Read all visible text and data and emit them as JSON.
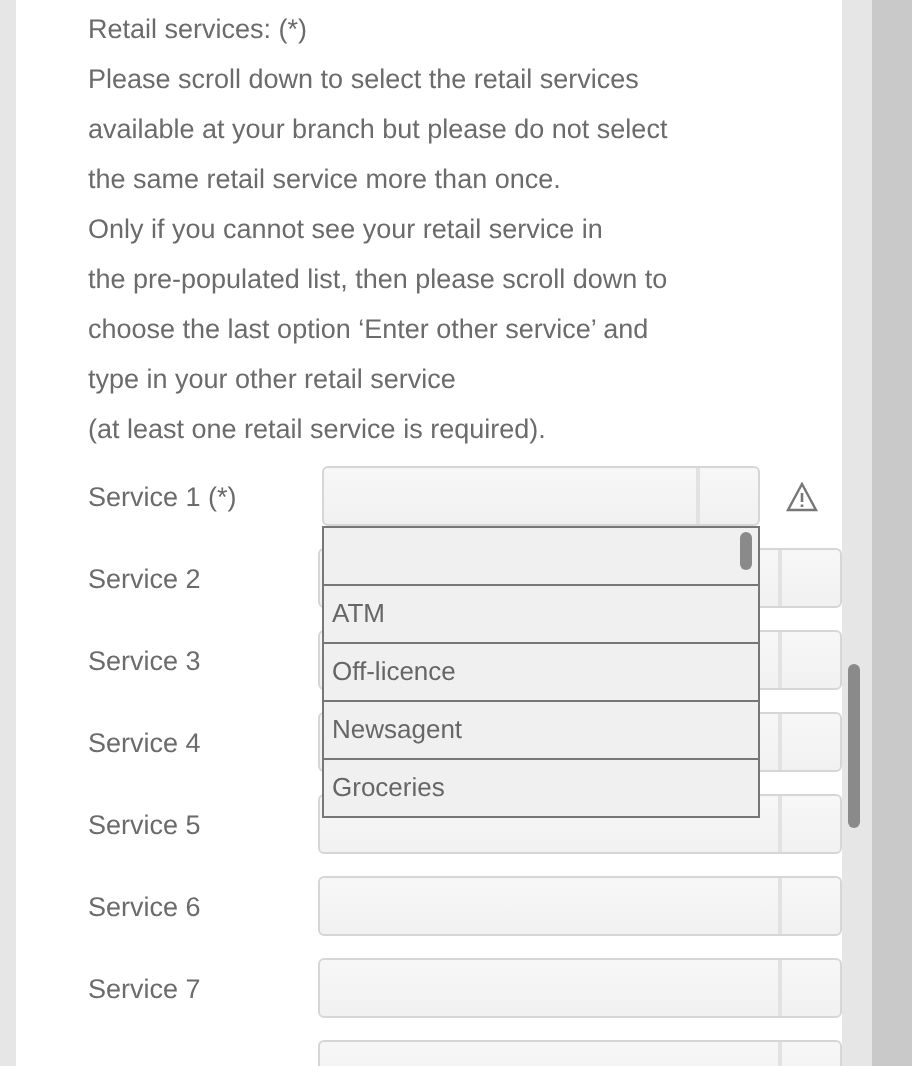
{
  "section": {
    "title": "Retail services: (*)",
    "instructions": [
      "Please scroll down to select the retail services",
      "available at your branch but please do not select",
      "the same retail service more than once.",
      "Only if you cannot see your retail service in",
      "the pre-populated list, then please scroll down to",
      "choose the last option ‘Enter other service’ and",
      "type in your other retail service",
      "(at least one retail service is required)."
    ]
  },
  "services": [
    {
      "label": "Service 1 (*)",
      "expanded": true,
      "warning": true
    },
    {
      "label": "Service 2",
      "expanded": false,
      "warning": false
    },
    {
      "label": "Service 3",
      "expanded": false,
      "warning": false
    },
    {
      "label": "Service 4",
      "expanded": false,
      "warning": false
    },
    {
      "label": "Service 5",
      "expanded": false,
      "warning": false
    },
    {
      "label": "Service 6",
      "expanded": false,
      "warning": false
    },
    {
      "label": "Service 7",
      "expanded": false,
      "warning": false
    },
    {
      "expanded": false,
      "warning": false
    }
  ],
  "dropdown": {
    "blank_option": true,
    "options": [
      "ATM",
      "Off-licence",
      "Newsagent",
      "Groceries"
    ]
  }
}
